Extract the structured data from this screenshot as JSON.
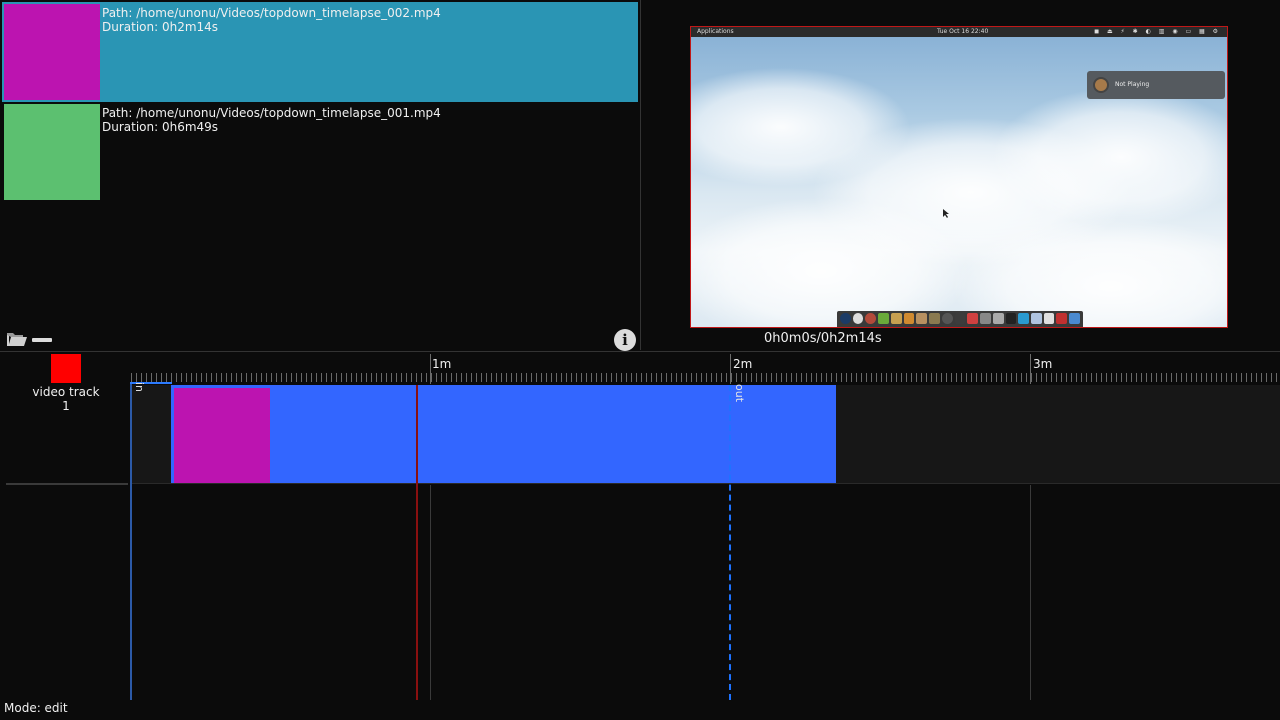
{
  "media_list": {
    "items": [
      {
        "path": "Path: /home/unonu/Videos/topdown_timelapse_002.mp4",
        "duration": "Duration: 0h2m14s",
        "thumb_color": "#bc14b0",
        "selected": true
      },
      {
        "path": "Path: /home/unonu/Videos/topdown_timelapse_001.mp4",
        "duration": "Duration: 0h6m49s",
        "thumb_color": "#5cc070",
        "selected": false
      }
    ],
    "toolbar": {
      "open_icon": "folder-icon",
      "remove_icon": "minus-icon",
      "info_icon": "info-icon",
      "info_glyph": "i"
    }
  },
  "preview": {
    "time": "0h0m0s/0h2m14s",
    "desktop": {
      "topbar_apps": "Applications",
      "topbar_clock": "Tue Oct 16 22:40",
      "topbar_tray": "◼ ⏏ ⚡ ✱ ◐ ▥ ◉ ▭ ▦ ⚙",
      "notification": "Not Playing"
    }
  },
  "timeline": {
    "ruler_labels": [
      "1m",
      "2m",
      "3m"
    ],
    "track": {
      "label_line1": "video track",
      "label_line2": "1",
      "color": "#ff0000"
    },
    "clip": {
      "color": "#3366ff",
      "thumb_color": "#bc14b0"
    },
    "in_label": "in",
    "out_label": "out"
  },
  "status": {
    "mode": "Mode: edit"
  }
}
